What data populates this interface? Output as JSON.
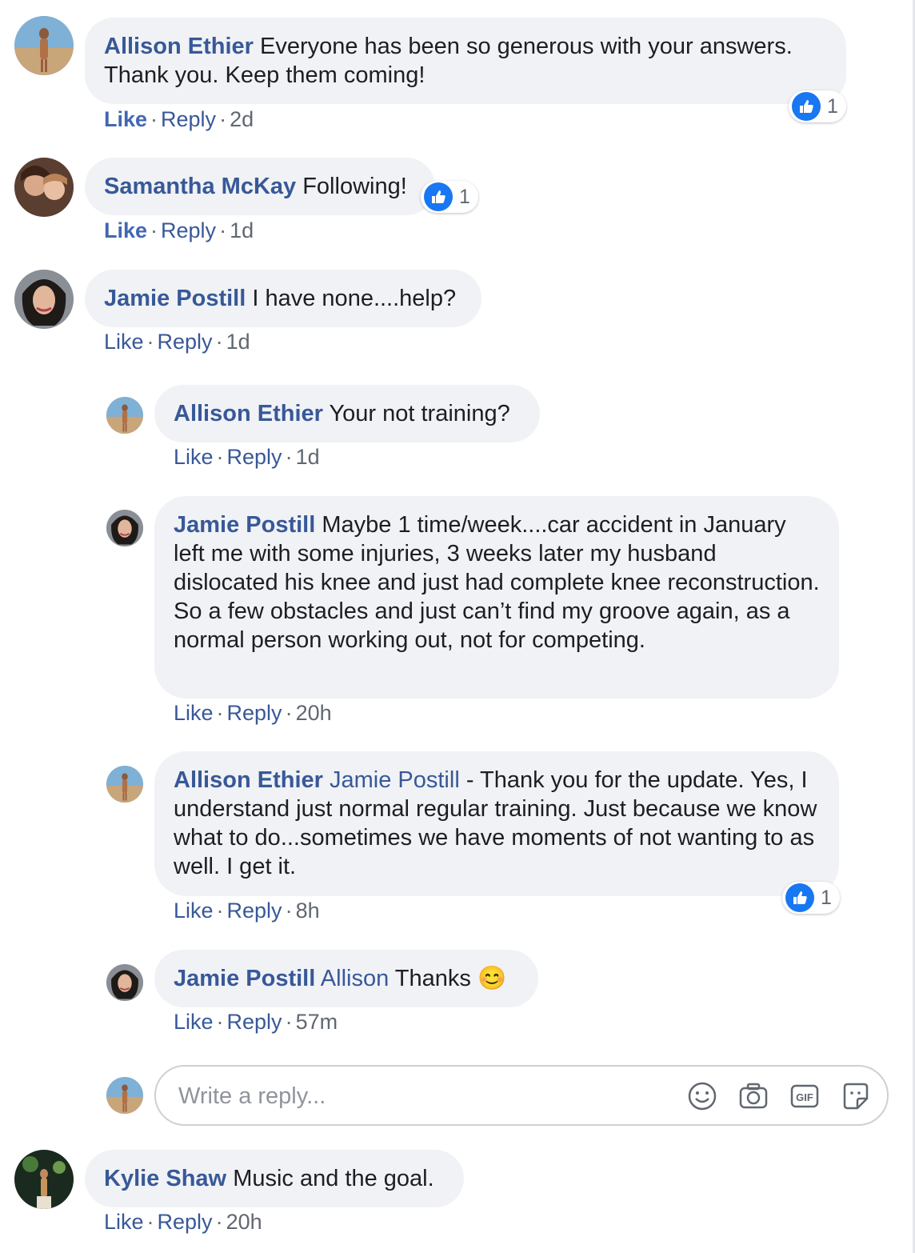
{
  "comments": [
    {
      "author": "Allison Ethier",
      "text": "Everyone has been so generous with your answers. Thank you. Keep them coming!",
      "actions": {
        "like": "Like",
        "reply": "Reply",
        "time": "2d"
      },
      "reaction_count": "1"
    },
    {
      "author": "Samantha McKay",
      "text": "Following!",
      "actions": {
        "like": "Like",
        "reply": "Reply",
        "time": "1d"
      },
      "reaction_count": "1"
    },
    {
      "author": "Jamie Postill",
      "text": "I have none....help?",
      "actions": {
        "like": "Like",
        "reply": "Reply",
        "time": "1d"
      },
      "replies": [
        {
          "author": "Allison Ethier",
          "text": "Your not training?",
          "actions": {
            "like": "Like",
            "reply": "Reply",
            "time": "1d"
          }
        },
        {
          "author": "Jamie Postill",
          "text": "Maybe 1 time/week....car accident in January left me with some injuries, 3 weeks later my husband dislocated his knee and just had complete knee reconstruction. So a few obstacles and just can’t find my groove again, as a normal person working out, not for competing.",
          "actions": {
            "like": "Like",
            "reply": "Reply",
            "time": "20h"
          }
        },
        {
          "author": "Allison Ethier",
          "mention": "Jamie Postill",
          "text": "- Thank you for the update. Yes, I understand just normal regular training. Just because we know what to do...sometimes we have moments of not wanting to as well. I get it.",
          "actions": {
            "like": "Like",
            "reply": "Reply",
            "time": "8h"
          },
          "reaction_count": "1"
        },
        {
          "author": "Jamie Postill",
          "mention": "Allison",
          "text": "Thanks",
          "emoji": "😊",
          "actions": {
            "like": "Like",
            "reply": "Reply",
            "time": "57m"
          }
        }
      ],
      "reply_box": {
        "placeholder": "Write a reply...",
        "icons": [
          "emoji-icon",
          "camera-icon",
          "gif-icon",
          "sticker-icon"
        ]
      }
    },
    {
      "author": "Kylie Shaw",
      "text": "Music and the goal.",
      "actions": {
        "like": "Like",
        "reply": "Reply",
        "time": "20h"
      }
    }
  ],
  "colors": {
    "name": "#385898",
    "bubble": "#f0f2f5",
    "like_badge": "#1877f2",
    "meta": "#606770"
  }
}
